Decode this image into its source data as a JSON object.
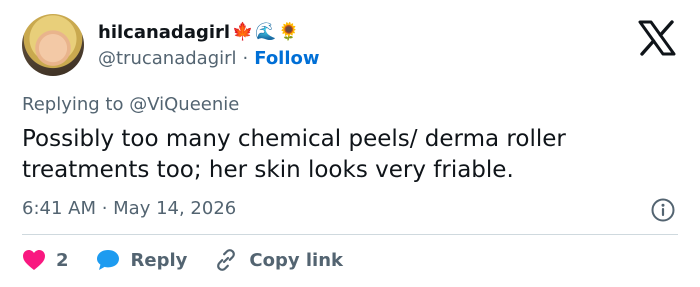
{
  "author": {
    "display_name": "hilcanadagirl",
    "name_emojis": [
      "🍁",
      "🌊",
      "🌻"
    ],
    "handle": "@trucanadagirl",
    "separator": "·",
    "follow_label": "Follow"
  },
  "reply_context": {
    "text": "Replying to @ViQueenie"
  },
  "tweet": {
    "text": "Possibly too many chemical peels/ derma roller treatments too; her skin looks very friable."
  },
  "meta": {
    "time_date": "6:41 AM · May 14, 2026"
  },
  "actions": {
    "like_count": "2",
    "reply_label": "Reply",
    "copy_link_label": "Copy link"
  },
  "colors": {
    "accent": "#006fd6",
    "muted": "#536471",
    "heart": "#f91880",
    "reply_bubble": "#1d9bf0",
    "divider": "#cfd9de"
  },
  "icons": {
    "brand": "x-logo-icon",
    "info": "info-icon",
    "like": "heart-icon",
    "reply": "speech-bubble-icon",
    "copy_link": "link-icon"
  }
}
